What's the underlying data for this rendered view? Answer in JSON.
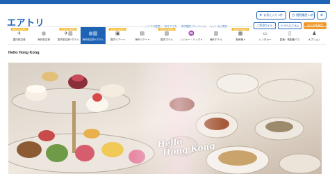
{
  "brand": {
    "logo": "エアトリ"
  },
  "header": {
    "login": "お気に入り 0件",
    "history": "閲覧履歴 10件",
    "language_icon": "globe-icon",
    "links": [
      "メルマガ登録",
      "初めての方",
      "予約確認 (マイページ)",
      "キャンセル受付"
    ],
    "help": "ご利用ガイド",
    "cta": "トラベルコラム",
    "corp": "法人出張専用"
  },
  "nav": {
    "items": [
      {
        "label": "国内航空券",
        "icon": "plane-icon",
        "badge": "往復割引実施中"
      },
      {
        "label": "海外航空券",
        "icon": "globe-icon",
        "badge": ""
      },
      {
        "label": "国内航空券+ホテル",
        "icon": "plane-hotel-icon",
        "badge": "往復割引実施中"
      },
      {
        "label": "海外航空券+ホテル",
        "icon": "globe-hotel-icon",
        "badge": ""
      },
      {
        "label": "国内ツアー ▾",
        "icon": "suitcase-icon",
        "badge": "往復割引実施中"
      },
      {
        "label": "海外ツアー ▾",
        "icon": "bag-icon",
        "badge": ""
      },
      {
        "label": "国内ホテル",
        "icon": "building-icon",
        "badge": "往復割引実施中"
      },
      {
        "label": "レジャー・バック ▾",
        "icon": "leisure-icon",
        "badge": ""
      },
      {
        "label": "海外ホテル",
        "icon": "hotel-icon",
        "badge": ""
      },
      {
        "label": "新幹線 ▾",
        "icon": "train-icon",
        "badge": "往復割引実施中"
      },
      {
        "label": "レンタカー",
        "icon": "car-icon",
        "badge": ""
      },
      {
        "label": "高速・長距離バス",
        "icon": "bus-icon",
        "badge": ""
      },
      {
        "label": "オプション",
        "icon": "person-icon",
        "badge": ""
      }
    ]
  },
  "page": {
    "title": "Hello Hong Kong"
  },
  "hero": {
    "caption_line1": "Hello",
    "caption_line2": "Hong Kong"
  },
  "colors": {
    "brand_blue": "#1f63b5",
    "accent_orange": "#f19a2a",
    "badge_yellow": "#f3b526"
  }
}
